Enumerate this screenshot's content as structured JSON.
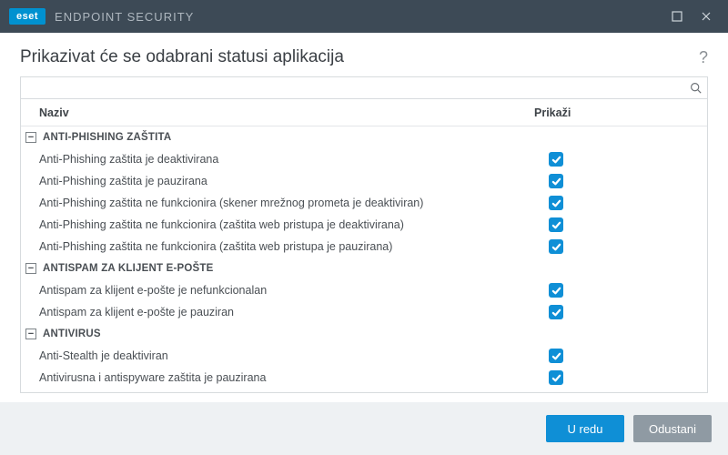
{
  "titlebar": {
    "brand_badge": "eset",
    "brand_text": "ENDPOINT SECURITY"
  },
  "header": {
    "page_title": "Prikazivat će se odabrani statusi aplikacija"
  },
  "search": {
    "value": "",
    "placeholder": ""
  },
  "table": {
    "columns": {
      "name": "Naziv",
      "show": "Prikaži"
    },
    "groups": [
      {
        "label": "ANTI-PHISHING ZAŠTITA",
        "expanded": true,
        "items": [
          {
            "name": "Anti-Phishing zaštita je deaktivirana",
            "checked": true
          },
          {
            "name": "Anti-Phishing zaštita je pauzirana",
            "checked": true
          },
          {
            "name": "Anti-Phishing zaštita ne funkcionira (skener mrežnog prometa je deaktiviran)",
            "checked": true
          },
          {
            "name": "Anti-Phishing zaštita ne funkcionira (zaštita web pristupa je deaktivirana)",
            "checked": true
          },
          {
            "name": "Anti-Phishing zaštita ne funkcionira (zaštita web pristupa je pauzirana)",
            "checked": true
          }
        ]
      },
      {
        "label": "ANTISPAM ZA KLIJENT E-POŠTE",
        "expanded": true,
        "items": [
          {
            "name": "Antispam za klijent e-pošte je nefunkcionalan",
            "checked": true
          },
          {
            "name": "Antispam za klijent e-pošte je pauziran",
            "checked": true
          }
        ]
      },
      {
        "label": "ANTIVIRUS",
        "expanded": true,
        "items": [
          {
            "name": "Anti-Stealth je deaktiviran",
            "checked": true
          },
          {
            "name": "Antivirusna i antispyware zaštita je pauzirana",
            "checked": true
          }
        ]
      }
    ]
  },
  "footer": {
    "ok_label": "U redu",
    "cancel_label": "Odustani"
  },
  "glyphs": {
    "minus": "−",
    "help": "?"
  }
}
